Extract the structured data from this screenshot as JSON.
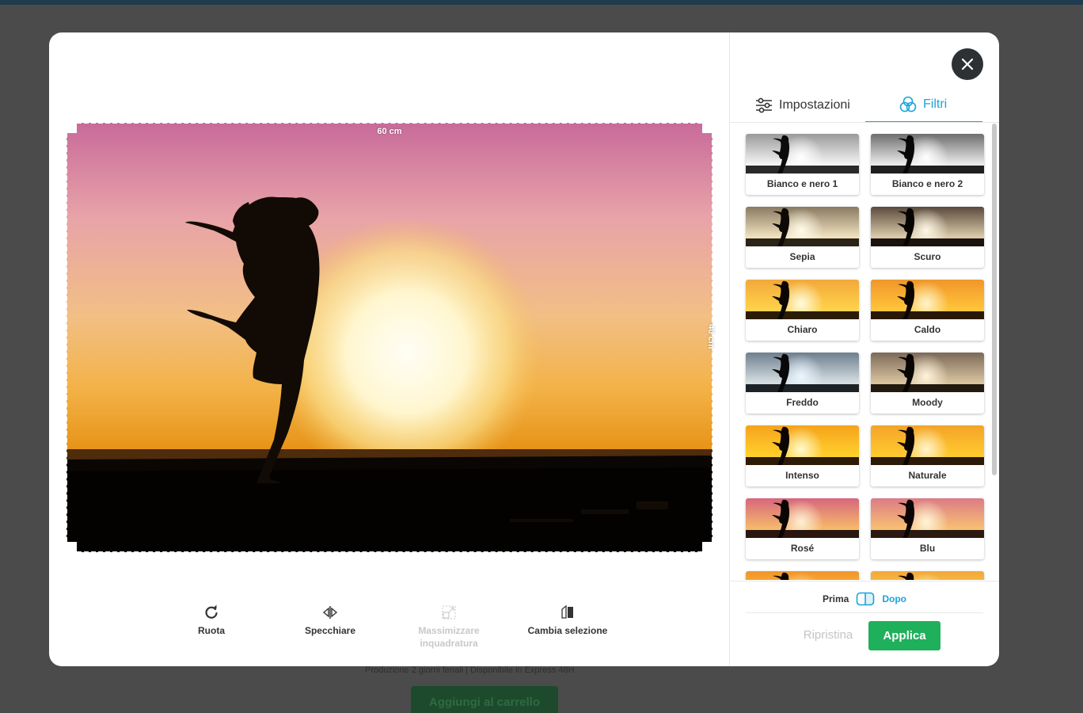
{
  "background": {
    "info_text": "Produzione 2 giorni feriali | Disponibile in Express 48H",
    "cart_button": "Aggiungi al carrello"
  },
  "editor": {
    "width_label": "60 cm",
    "height_label": "40 cm"
  },
  "toolbar": {
    "rotate": "Ruota",
    "mirror": "Specchiare",
    "maximize_line1": "Massimizzare",
    "maximize_line2": "inquadratura",
    "change_selection": "Cambia selezione"
  },
  "tabs": {
    "settings": "Impostazioni",
    "filters": "Filtri"
  },
  "filters": [
    {
      "name": "Bianco e nero 1",
      "tone": "gray1"
    },
    {
      "name": "Bianco e nero 2",
      "tone": "gray2"
    },
    {
      "name": "Sepia",
      "tone": "sepia"
    },
    {
      "name": "Scuro",
      "tone": "dark"
    },
    {
      "name": "Chiaro",
      "tone": "bright"
    },
    {
      "name": "Caldo",
      "tone": "warm"
    },
    {
      "name": "Freddo",
      "tone": "cold"
    },
    {
      "name": "Moody",
      "tone": "moody"
    },
    {
      "name": "Intenso",
      "tone": "intense"
    },
    {
      "name": "Naturale",
      "tone": "natural"
    },
    {
      "name": "Rosé",
      "tone": "rose"
    },
    {
      "name": "Blu",
      "tone": "blue"
    },
    {
      "name": "",
      "tone": "warm"
    },
    {
      "name": "",
      "tone": "bright"
    }
  ],
  "compare": {
    "before": "Prima",
    "after": "Dopo"
  },
  "actions": {
    "reset": "Ripristina",
    "apply": "Applica"
  },
  "colors": {
    "accent": "#1aa3d9",
    "apply": "#1eb05a"
  }
}
